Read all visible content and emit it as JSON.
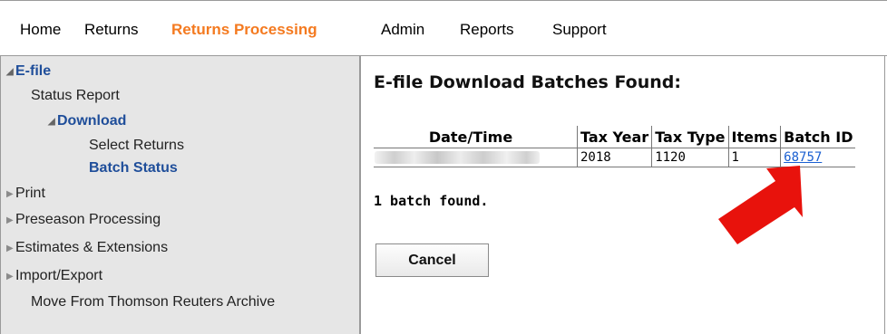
{
  "nav": {
    "items": [
      {
        "label": "Home"
      },
      {
        "label": "Returns"
      },
      {
        "label": "Returns Processing",
        "active": true
      },
      {
        "label": "Admin"
      },
      {
        "label": "Reports"
      },
      {
        "label": "Support"
      }
    ]
  },
  "sidebar": {
    "efile": "E-file",
    "status_report": "Status Report",
    "download": "Download",
    "select_returns": "Select Returns",
    "batch_status": "Batch Status",
    "print": "Print",
    "preseason": "Preseason Processing",
    "estimates": "Estimates & Extensions",
    "import_export": "Import/Export",
    "move_archive": "Move From Thomson Reuters Archive"
  },
  "main": {
    "heading": "E-file Download Batches Found:",
    "table": {
      "headers": [
        "Date/Time",
        "Tax Year",
        "Tax Type",
        "Items",
        "Batch ID"
      ],
      "row": {
        "date_time": "",
        "tax_year": "2018",
        "tax_type": "1120",
        "items": "1",
        "batch_id": "68757"
      }
    },
    "found_text": "1 batch found.",
    "cancel_label": "Cancel"
  },
  "colors": {
    "accent_orange": "#f47a20",
    "sidebar_blue": "#1f4e9a",
    "link_blue": "#1a5fd1",
    "annotation_arrow": "#e8120c"
  },
  "icons": [
    "triangle-open-icon",
    "triangle-closed-icon",
    "red-arrow-annotation"
  ]
}
